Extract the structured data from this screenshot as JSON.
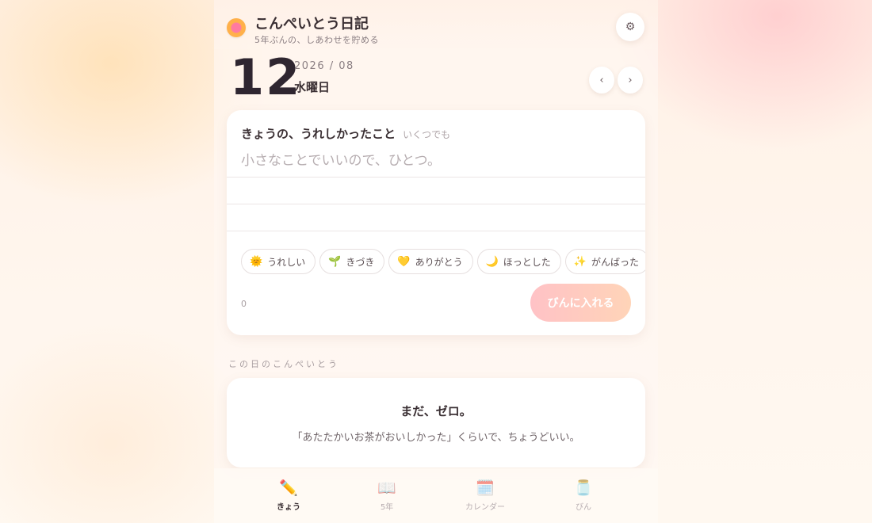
{
  "header": {
    "title": "こんぺいとう日記",
    "subtitle": "5年ぶんの、しあわせを貯める",
    "settings_icon": "⚙"
  },
  "date": {
    "day": "12",
    "year_month": "2026 / 08",
    "weekday": "水曜日",
    "prev_label": "‹",
    "next_label": "›"
  },
  "entry": {
    "title": "きょうの、うれしかったこと",
    "hint": "いくつでも",
    "placeholder": "小さなことでいいので、ひとつ。",
    "value": "",
    "chips": [
      {
        "emoji": "🌞",
        "label": "うれしい"
      },
      {
        "emoji": "🌱",
        "label": "きづき"
      },
      {
        "emoji": "💛",
        "label": "ありがとう"
      },
      {
        "emoji": "🌙",
        "label": "ほっとした"
      },
      {
        "emoji": "✨",
        "label": "がんばった"
      }
    ],
    "count": "0",
    "submit_label": "びんに入れる"
  },
  "day_section": {
    "label": "この日のこんぺいとう",
    "empty_title": "まだ、ゼロ。",
    "empty_text": "「あたたかいお茶がおいしかった」くらいで、ちょうどいい。"
  },
  "nav": {
    "tabs": [
      {
        "icon": "✏️",
        "label": "きょう",
        "active": true
      },
      {
        "icon": "📖",
        "label": "5年",
        "active": false
      },
      {
        "icon": "🗓️",
        "label": "カレンダー",
        "active": false
      },
      {
        "icon": "🫙",
        "label": "びん",
        "active": false
      }
    ]
  },
  "colors": {
    "accent_pink": "#ff7aa0",
    "accent_orange": "#ffb04a",
    "button_gradient_start": "#ffc2c6",
    "button_gradient_end": "#ffd4b8"
  }
}
